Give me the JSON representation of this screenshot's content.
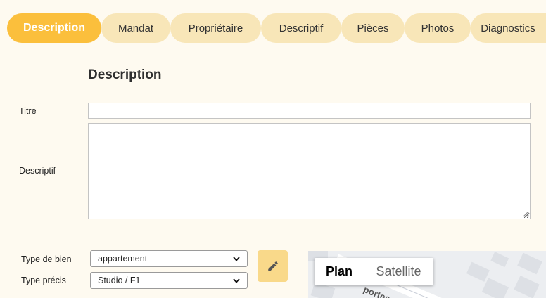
{
  "tabs": [
    {
      "label": "Description",
      "active": true
    },
    {
      "label": "Mandat"
    },
    {
      "label": "Propriétaire"
    },
    {
      "label": "Descriptif"
    },
    {
      "label": "Pièces"
    },
    {
      "label": "Photos"
    },
    {
      "label": "Diagnostics"
    }
  ],
  "section": {
    "title": "Description"
  },
  "form": {
    "titre": {
      "label": "Titre",
      "value": ""
    },
    "descriptif": {
      "label": "Descriptif",
      "value": ""
    },
    "type_de_bien": {
      "label": "Type de bien",
      "value": "appartement"
    },
    "type_precis": {
      "label": "Type précis",
      "value": "Studio / F1"
    },
    "edit_icon": "pencil-icon"
  },
  "map": {
    "plan_label": "Plan",
    "satellite_label": "Satellite",
    "street_fragment": "portes"
  },
  "colors": {
    "accent": "#fbbf3c",
    "tab_inactive": "#f8e6b8",
    "background": "#fefaf0",
    "edit_button": "#f9d98a"
  }
}
